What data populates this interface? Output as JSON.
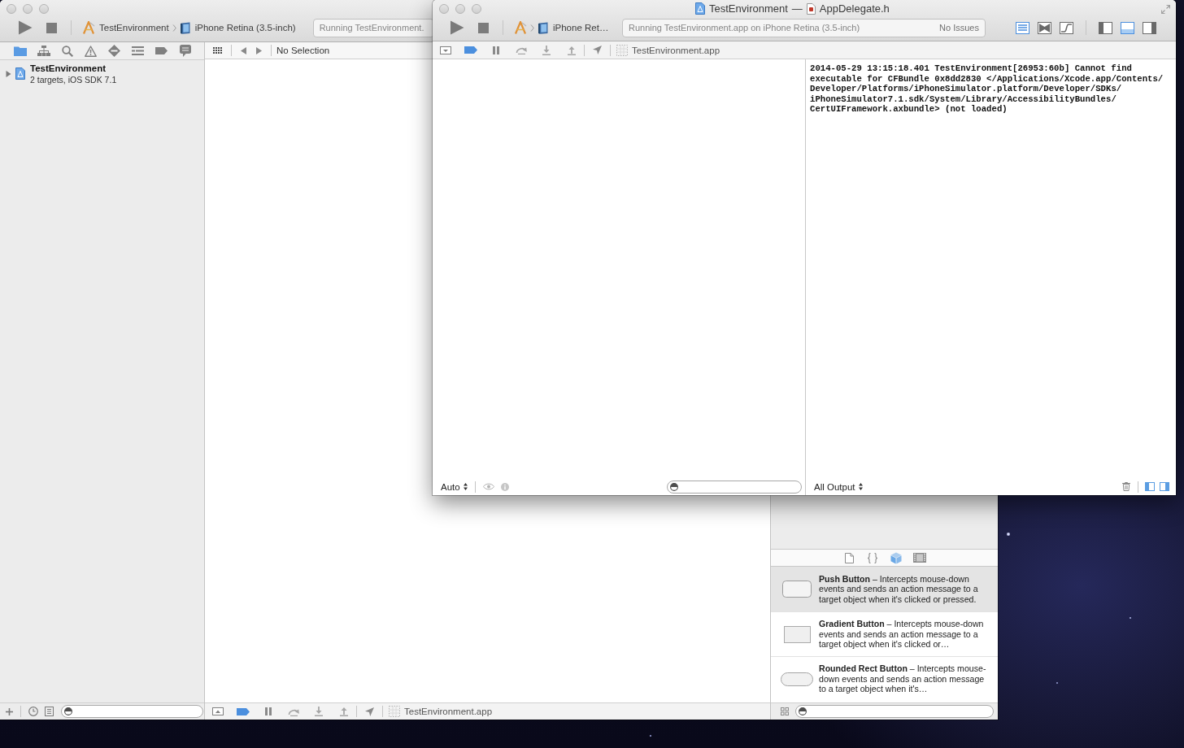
{
  "main_window": {
    "toolbar": {
      "scheme": "TestEnvironment",
      "destination": "iPhone Retina (3.5-inch)",
      "status": "Running TestEnvironment."
    },
    "navigator_tabs": [
      {
        "kind": "folder",
        "selected": true
      },
      {
        "kind": "hierarchy",
        "selected": false
      },
      {
        "kind": "search",
        "selected": false
      },
      {
        "kind": "warning",
        "selected": false
      },
      {
        "kind": "diamond",
        "selected": false
      },
      {
        "kind": "lines",
        "selected": false
      },
      {
        "kind": "tag",
        "selected": false
      },
      {
        "kind": "bubble",
        "selected": false
      }
    ],
    "project_tree": [
      {
        "name": "TestEnvironment",
        "detail": "2 targets, iOS SDK 7.1",
        "expanded": false
      }
    ],
    "jump_bar": {
      "path": "No Selection"
    },
    "debug_bar": {
      "debug_area_shown": false,
      "breakpoints_active": true,
      "process": "TestEnvironment.app"
    },
    "library": {
      "tabs": [
        {
          "kind": "file",
          "selected": false
        },
        {
          "kind": "braces",
          "selected": false
        },
        {
          "kind": "cube",
          "selected": true
        },
        {
          "kind": "film",
          "selected": false
        }
      ],
      "items": [
        {
          "kind": "rounded",
          "selected": true,
          "description": "**Push Button** – Intercepts mouse-down events and sends an action message to a target object when it's clicked or pressed."
        },
        {
          "kind": "square",
          "selected": false,
          "description": "**Gradient Button** – Intercepts mouse-down events and sends an action message to a target object when it's clicked or…"
        },
        {
          "kind": "pill",
          "selected": false,
          "description": "**Rounded Rect Button** – Intercepts mouse-down events and sends an action message to a target object when it's…"
        }
      ]
    }
  },
  "editor_window": {
    "title": {
      "project": "TestEnvironment",
      "separator": "—",
      "file": "AppDelegate.h"
    },
    "toolbar": {
      "destination": "iPhone Ret…",
      "status": "Running TestEnvironment.app on iPhone Retina (3.5-inch)",
      "issues": "No Issues",
      "editor_modes": [
        {
          "kind": "standard",
          "selected": true
        },
        {
          "kind": "assistant",
          "selected": false
        },
        {
          "kind": "version",
          "selected": false
        }
      ],
      "views": [
        {
          "kind": "navigator",
          "on": false
        },
        {
          "kind": "debug",
          "on": true
        },
        {
          "kind": "utilities",
          "on": false
        }
      ]
    },
    "debug_bar": {
      "debug_area_shown": true,
      "breakpoints_active": true,
      "process": "TestEnvironment.app"
    },
    "variables": {
      "scope": "Auto"
    },
    "console": {
      "log": "2014-05-29 13:15:18.401 TestEnvironment[26953:60b] Cannot find executable for CFBundle 0x8dd2830 </Applications/Xcode.app/Contents/Developer/Platforms/iPhoneSimulator.platform/Developer/SDKs/iPhoneSimulator7.1.sdk/System/Library/AccessibilityBundles/CertUIFramework.axbundle> (not loaded)",
      "filter": "All Output",
      "panes": [
        {
          "kind": "variables",
          "on": true
        },
        {
          "kind": "console",
          "on": true
        }
      ]
    }
  }
}
